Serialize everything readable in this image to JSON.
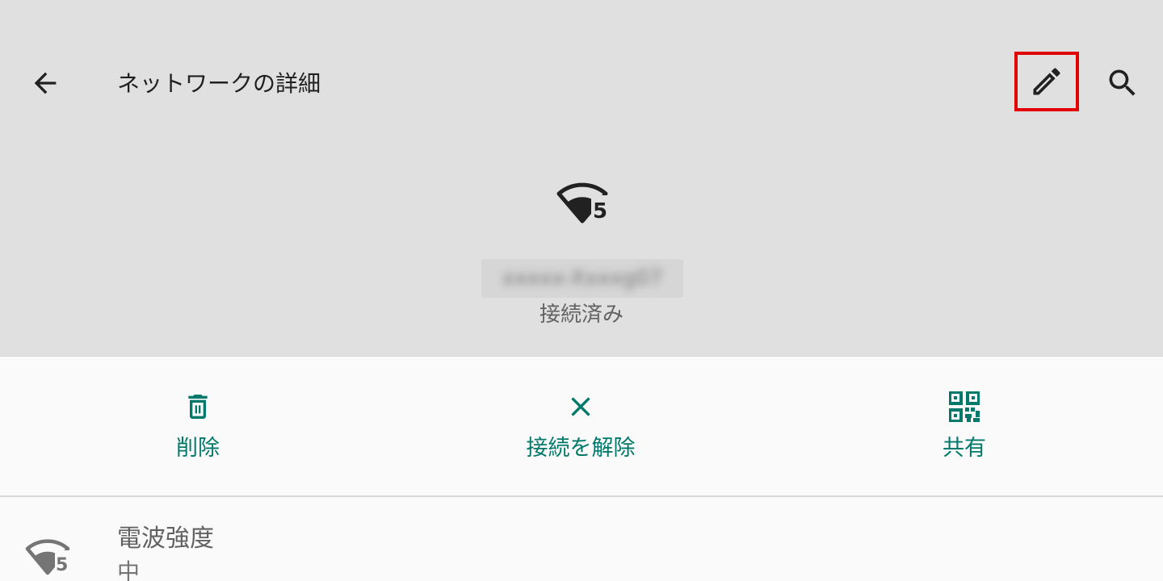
{
  "appbar": {
    "title": "ネットワークの詳細",
    "back_icon": "arrow-back-icon",
    "edit_icon": "pencil-icon",
    "search_icon": "search-icon"
  },
  "network": {
    "icon": "wifi-5ghz-icon",
    "badge": "5",
    "ssid": "xxxxx-Xxxxg07",
    "status": "接続済み"
  },
  "actions": [
    {
      "label": "削除",
      "icon": "trash-icon"
    },
    {
      "label": "接続を解除",
      "icon": "close-icon"
    },
    {
      "label": "共有",
      "icon": "qr-code-icon"
    }
  ],
  "details": [
    {
      "title": "電波強度",
      "value": "中",
      "icon": "wifi-5ghz-icon",
      "badge": "5"
    }
  ],
  "colors": {
    "header_bg": "#e0e0e0",
    "accent": "#00796b",
    "highlight_border": "#e00000"
  }
}
